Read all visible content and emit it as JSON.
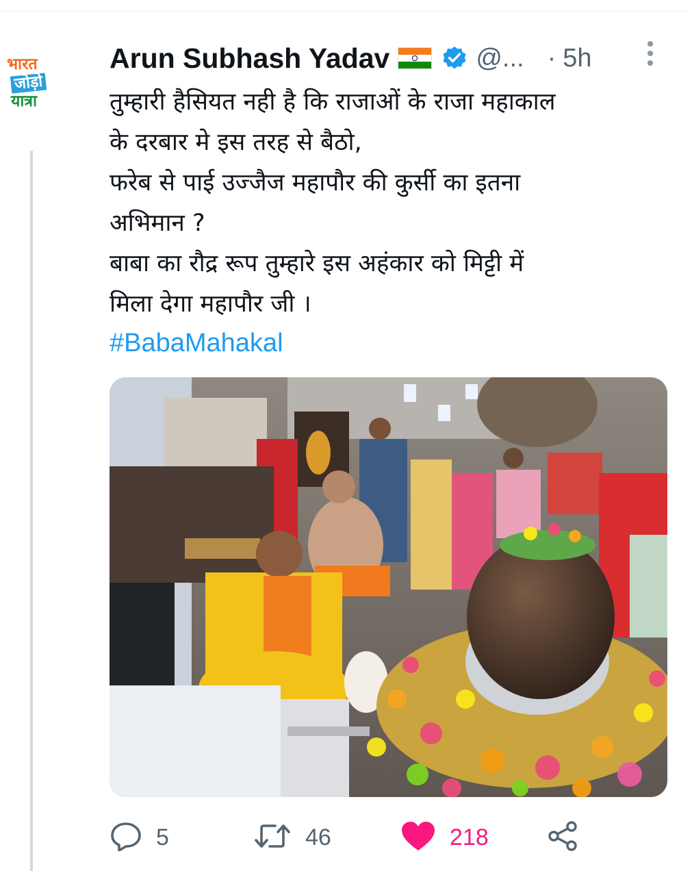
{
  "avatar": {
    "logo_lines": [
      "भारत",
      "जोड़ो",
      "यात्रा"
    ],
    "icon": "bharat-jodo-yatra-logo"
  },
  "tweet": {
    "author": "Arun Subhash Yadav",
    "handle": "@...",
    "separator": "·",
    "time": "5h",
    "text_lines": [
      "तुम्हारी हैसियत नही है कि राजाओं के राजा महाकाल",
      "के दरबार मे इस तरह से बैठो,",
      "फरेब से पाई उज्जैज महापौर की कुर्सी का इतना",
      "अभिमान ?",
      "बाबा का रौद्र रूप तुम्हारे इस अहंकार को मिट्टी में",
      "मिला देगा महापौर जी ।"
    ],
    "hashtag": "#BabaMahakal",
    "media_icon": "temple-photo"
  },
  "actions": {
    "reply": {
      "icon": "reply-icon",
      "count": "5"
    },
    "retweet": {
      "icon": "retweet-icon",
      "count": "46"
    },
    "like": {
      "icon": "heart-icon",
      "count": "218",
      "liked": true
    },
    "share": {
      "icon": "share-icon"
    }
  },
  "colors": {
    "text": "#0f1419",
    "secondary": "#536471",
    "link": "#1d9bf0",
    "like": "#f91880",
    "thread_line": "#cfd9de"
  }
}
